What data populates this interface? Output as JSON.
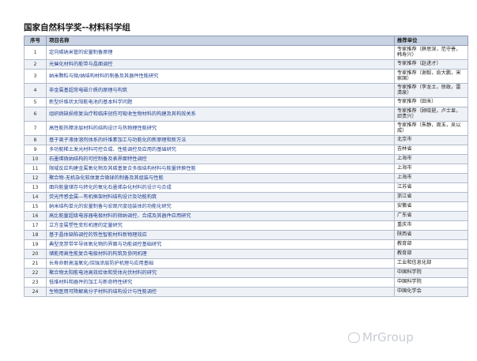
{
  "title": "国家自然科学奖--材料科学组",
  "columns": {
    "no": "序号",
    "name": "项目名称",
    "recommender": "推荐单位"
  },
  "rows": [
    {
      "no": "1",
      "name": "定向碳纳米管的宏量制备原理",
      "recommender": "专家推荐（薛思深，范守善，韩寿兴）",
      "tall": true
    },
    {
      "no": "2",
      "name": "光催化材料的能带与晶面调控",
      "recommender": "专家推荐（赵进才）",
      "tall": false
    },
    {
      "no": "3",
      "name": "纳米颗粒与微/纳结构材料的制备及其器件性能研究",
      "recommender": "专家推荐（谢毅，俞大鹏，宋家国）",
      "tall": true
    },
    {
      "no": "4",
      "name": "非金属基超常电磁介质的原理与构筑",
      "recommender": "专家推荐（李龙土，徐政，雷清泉）",
      "tall": true
    },
    {
      "no": "5",
      "name": "新型纤维状太阳能电池的基本科学问题",
      "recommender": "专家推荐（田禾）",
      "tall": false
    },
    {
      "no": "6",
      "name": "组织病缺损修复治疗和临床创伤可吸收生物材料的构建及其构效关系",
      "recommender": "专家推荐（顾晓崑，卢士显，邱贵兴）",
      "tall": true
    },
    {
      "no": "7",
      "name": "高性能热障涂层材料的结构设计与热物理性能研究",
      "recommender": "专家推荐（朱静，周玉，吴以成）",
      "tall": true
    },
    {
      "no": "8",
      "name": "基于离子液体溶剂体系的纤维素加工与功能化的新原理和新方法",
      "recommender": "北京市",
      "tall": false
    },
    {
      "no": "9",
      "name": "多功能稀土发光材料可控合成、性能调控及应用的基础研究",
      "recommender": "吉林省",
      "tall": false
    },
    {
      "no": "10",
      "name": "石墨烯微纳结构的可控制备及表界面特性调控",
      "recommender": "上海市",
      "tall": false
    },
    {
      "no": "11",
      "name": "限域反应构建金属氧化物及其碳基复合多级结构材料与能量转换性能",
      "recommender": "上海市",
      "tall": false
    },
    {
      "no": "12",
      "name": "聚合物-无机杂化软体复合微球的制备及其组装与性能",
      "recommender": "上海市",
      "tall": false
    },
    {
      "no": "13",
      "name": "面向能量储存与转化的氧化石墨烯杂化材料的设计与合成",
      "recommender": "江苏省",
      "tall": false
    },
    {
      "no": "14",
      "name": "荧光传感金属—有机框架材料结构设计及功能构筑",
      "recommender": "浙江省",
      "tall": false
    },
    {
      "no": "15",
      "name": "纳米结构单元的宏量制备与宏观尺度组装体的功能化研究",
      "recommender": "安徽省",
      "tall": false
    },
    {
      "no": "16",
      "name": "高比能量超级电容器电极材料的微纳调控、合成及其器件应用研究",
      "recommender": "广东省",
      "tall": false
    },
    {
      "no": "17",
      "name": "立方金属塑性变形机理的定量研究",
      "recommender": "重庆市",
      "tall": false
    },
    {
      "no": "18",
      "name": "基于晶体缺陷调控的铁性智能材料新物理效应",
      "recommender": "陕西省",
      "tall": false
    },
    {
      "no": "19",
      "name": "典型宽禁带半导体氧化物的界面与功能调控基础研究",
      "recommender": "教育部",
      "tall": false
    },
    {
      "no": "20",
      "name": "储能用高性能复合电极材料的构筑及协同机理",
      "recommender": "教育部",
      "tall": false
    },
    {
      "no": "21",
      "name": "长寿命耐高温氧化/烧蚀涂层防护机理与应用基础",
      "recommender": "工业和信息化部",
      "tall": false
    },
    {
      "no": "22",
      "name": "聚合物太阳能电池高效给体和受体光伏材料的研究",
      "recommender": "中国科学院",
      "tall": false
    },
    {
      "no": "23",
      "name": "低维材料和器件的加工与新奇特性研究",
      "recommender": "中国科学院",
      "tall": false
    },
    {
      "no": "24",
      "name": "生物医用可降解高分子材料的结构设计与性能调控",
      "recommender": "中国化学会",
      "tall": false
    }
  ],
  "watermark": "MrGroup"
}
